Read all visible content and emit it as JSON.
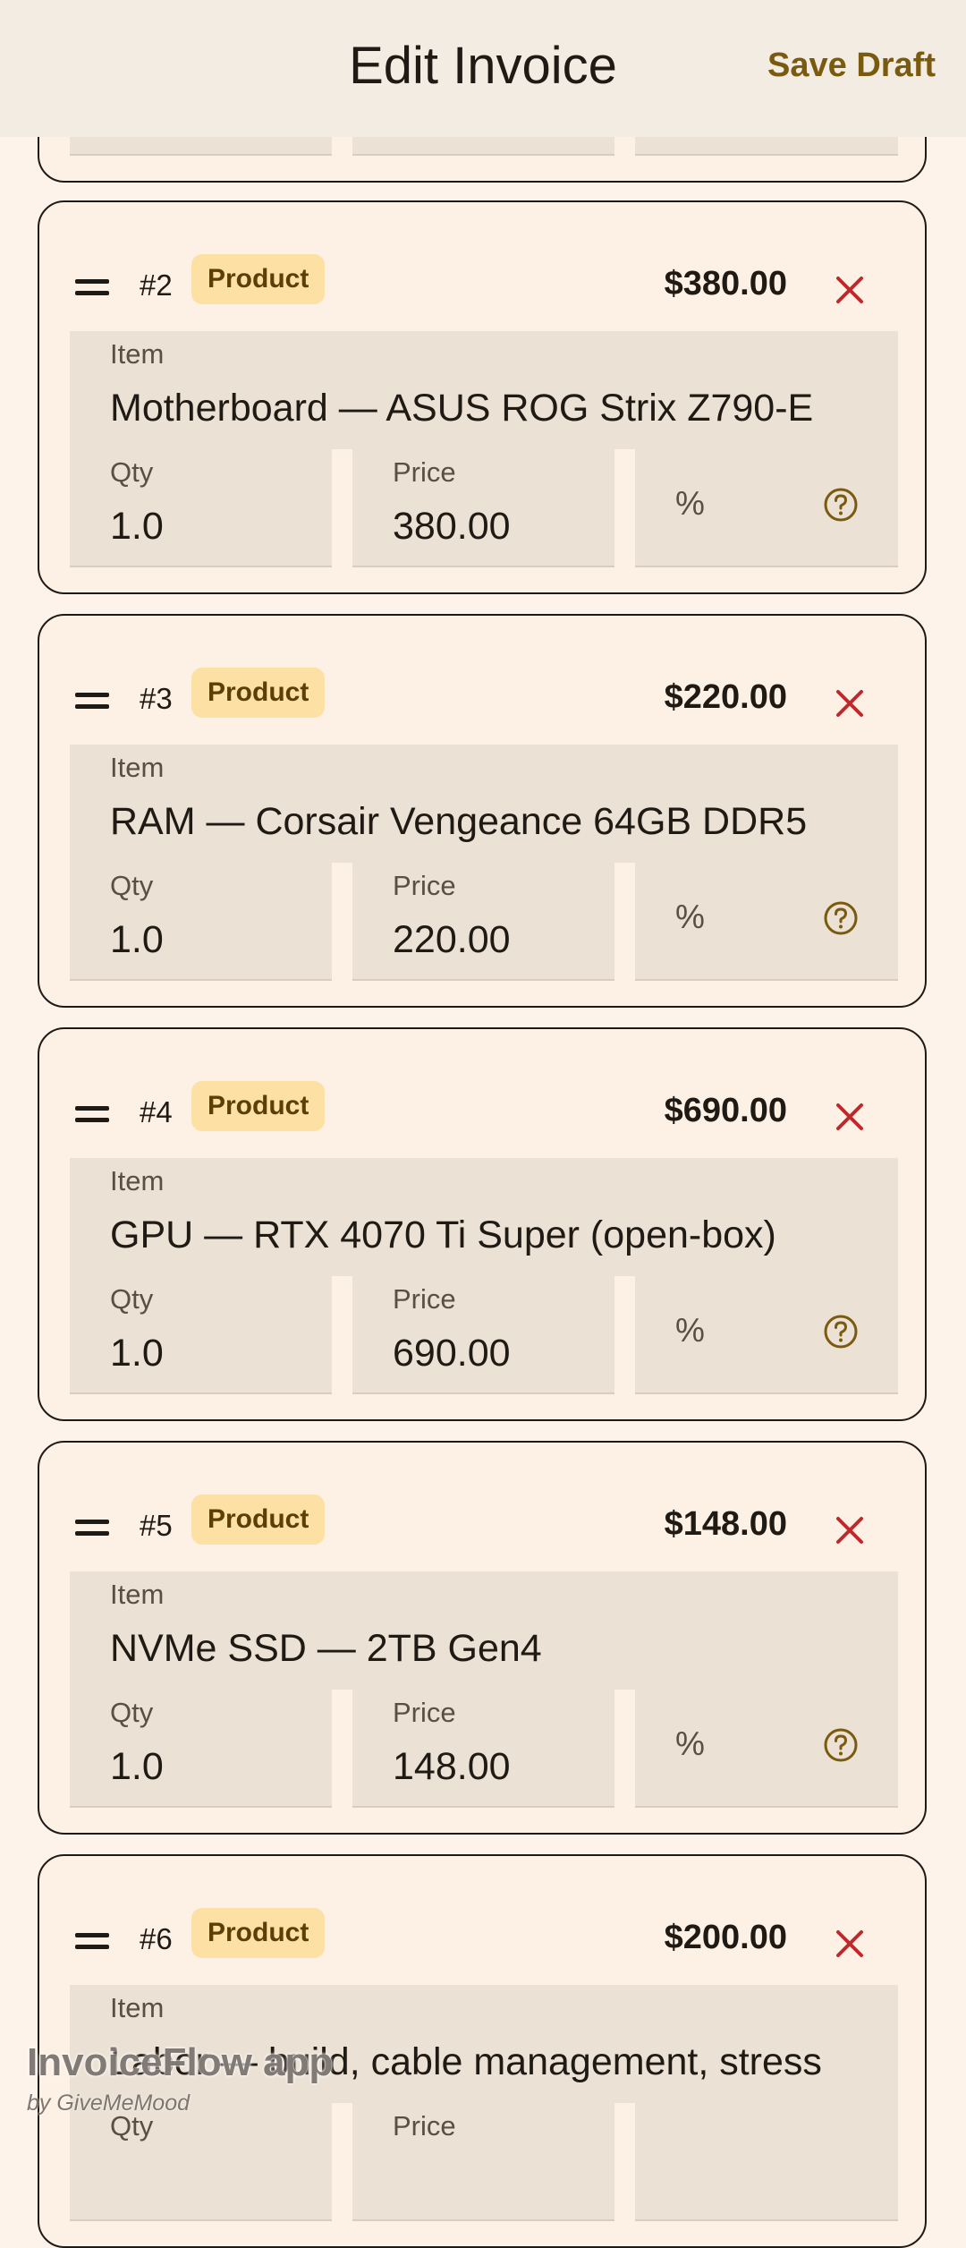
{
  "header": {
    "title": "Edit Invoice",
    "save_label": "Save Draft"
  },
  "field_labels": {
    "item": "Item",
    "qty": "Qty",
    "price": "Price",
    "discount": "%"
  },
  "icons": {
    "drag": "drag-handle-icon",
    "remove": "close-icon",
    "help": "help-circle-icon"
  },
  "colors": {
    "accent": "#7a5a0f",
    "remove": "#c0292b",
    "badge_bg": "#fde0a3",
    "card_bg": "#fdf0e4",
    "header_bg": "#f3ece2"
  },
  "items": [
    {
      "number": "#2",
      "type": "Product",
      "amount": "$380.00",
      "item": "Motherboard — ASUS ROG Strix Z790-E",
      "qty": "1.0",
      "price": "380.00"
    },
    {
      "number": "#3",
      "type": "Product",
      "amount": "$220.00",
      "item": "RAM — Corsair Vengeance 64GB DDR5",
      "qty": "1.0",
      "price": "220.00"
    },
    {
      "number": "#4",
      "type": "Product",
      "amount": "$690.00",
      "item": "GPU — RTX 4070 Ti Super (open-box)",
      "qty": "1.0",
      "price": "690.00"
    },
    {
      "number": "#5",
      "type": "Product",
      "amount": "$148.00",
      "item": "NVMe SSD — 2TB Gen4",
      "qty": "1.0",
      "price": "148.00"
    },
    {
      "number": "#6",
      "type": "Product",
      "amount": "$200.00",
      "item": "Labor — build, cable management, stress",
      "qty": "",
      "price": ""
    }
  ],
  "watermark": {
    "title": "InvoiceFlow app",
    "subtitle": "by GiveMeMood"
  }
}
